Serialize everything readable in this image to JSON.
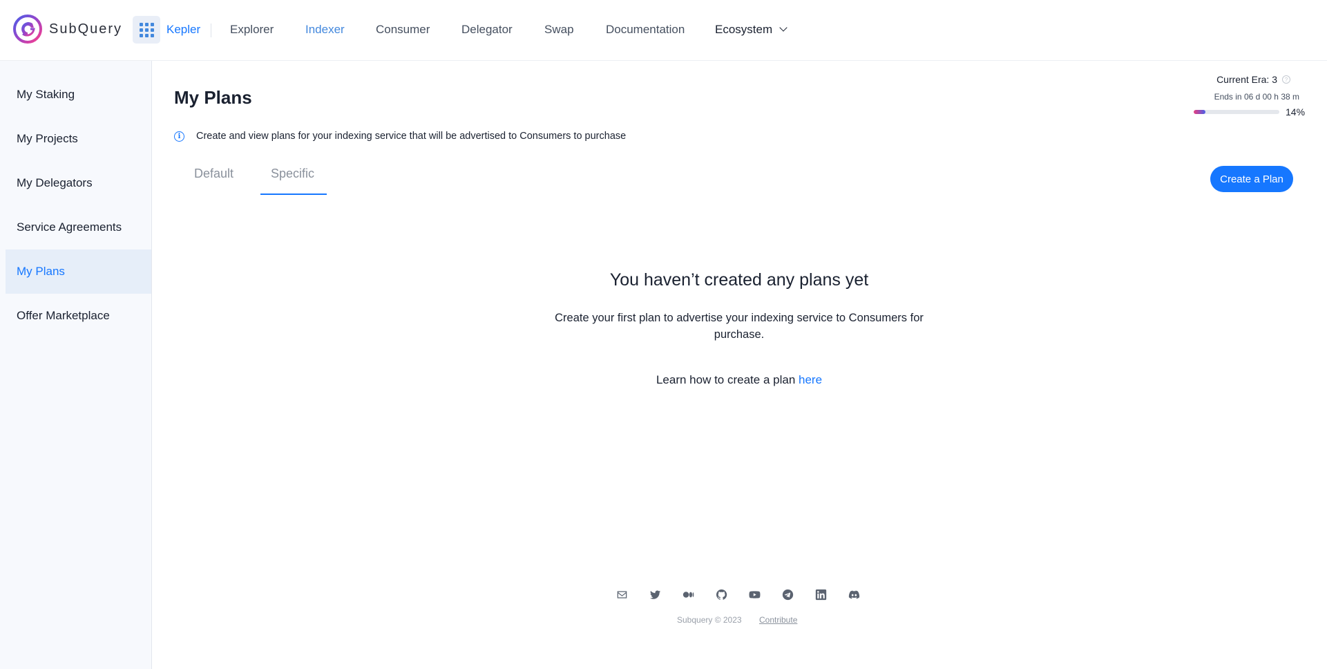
{
  "brand": {
    "name": "SubQuery"
  },
  "nav": {
    "app_name": "Kepler",
    "links": [
      "Explorer",
      "Indexer",
      "Consumer",
      "Delegator",
      "Swap",
      "Documentation"
    ],
    "ecosystem": "Ecosystem",
    "active": "Indexer"
  },
  "sidebar": {
    "items": [
      {
        "label": "My Staking"
      },
      {
        "label": "My Projects"
      },
      {
        "label": "My Delegators"
      },
      {
        "label": "Service Agreements"
      },
      {
        "label": "My Plans"
      },
      {
        "label": "Offer Marketplace"
      }
    ],
    "active": "My Plans"
  },
  "main": {
    "title": "My Plans",
    "info": "Create and view plans for your indexing service that will be advertised to Consumers to purchase",
    "tabs": [
      "Default",
      "Specific"
    ],
    "active_tab": "Specific",
    "create_button": "Create a Plan"
  },
  "era": {
    "current_label": "Current Era: 3",
    "ends": "Ends in 06 d 00 h 38 m",
    "progress_pct": 14,
    "progress_label": "14%"
  },
  "empty_state": {
    "title": "You haven’t created any plans yet",
    "description": "Create your first plan to advertise your indexing service to Consumers for purchase.",
    "learn_prefix": "Learn how to create a plan ",
    "learn_link": "here"
  },
  "footer": {
    "social_icons": [
      "mail-icon",
      "twitter-icon",
      "medium-icon",
      "github-icon",
      "youtube-icon",
      "telegram-icon",
      "linkedin-icon",
      "discord-icon"
    ],
    "copyright": "Subquery © 2023",
    "contribute": "Contribute"
  },
  "colors": {
    "accent": "#1677ff",
    "nav_active": "#4388dd",
    "sidebar_bg": "#f7f9fd",
    "sidebar_active_bg": "#e6eef9"
  }
}
